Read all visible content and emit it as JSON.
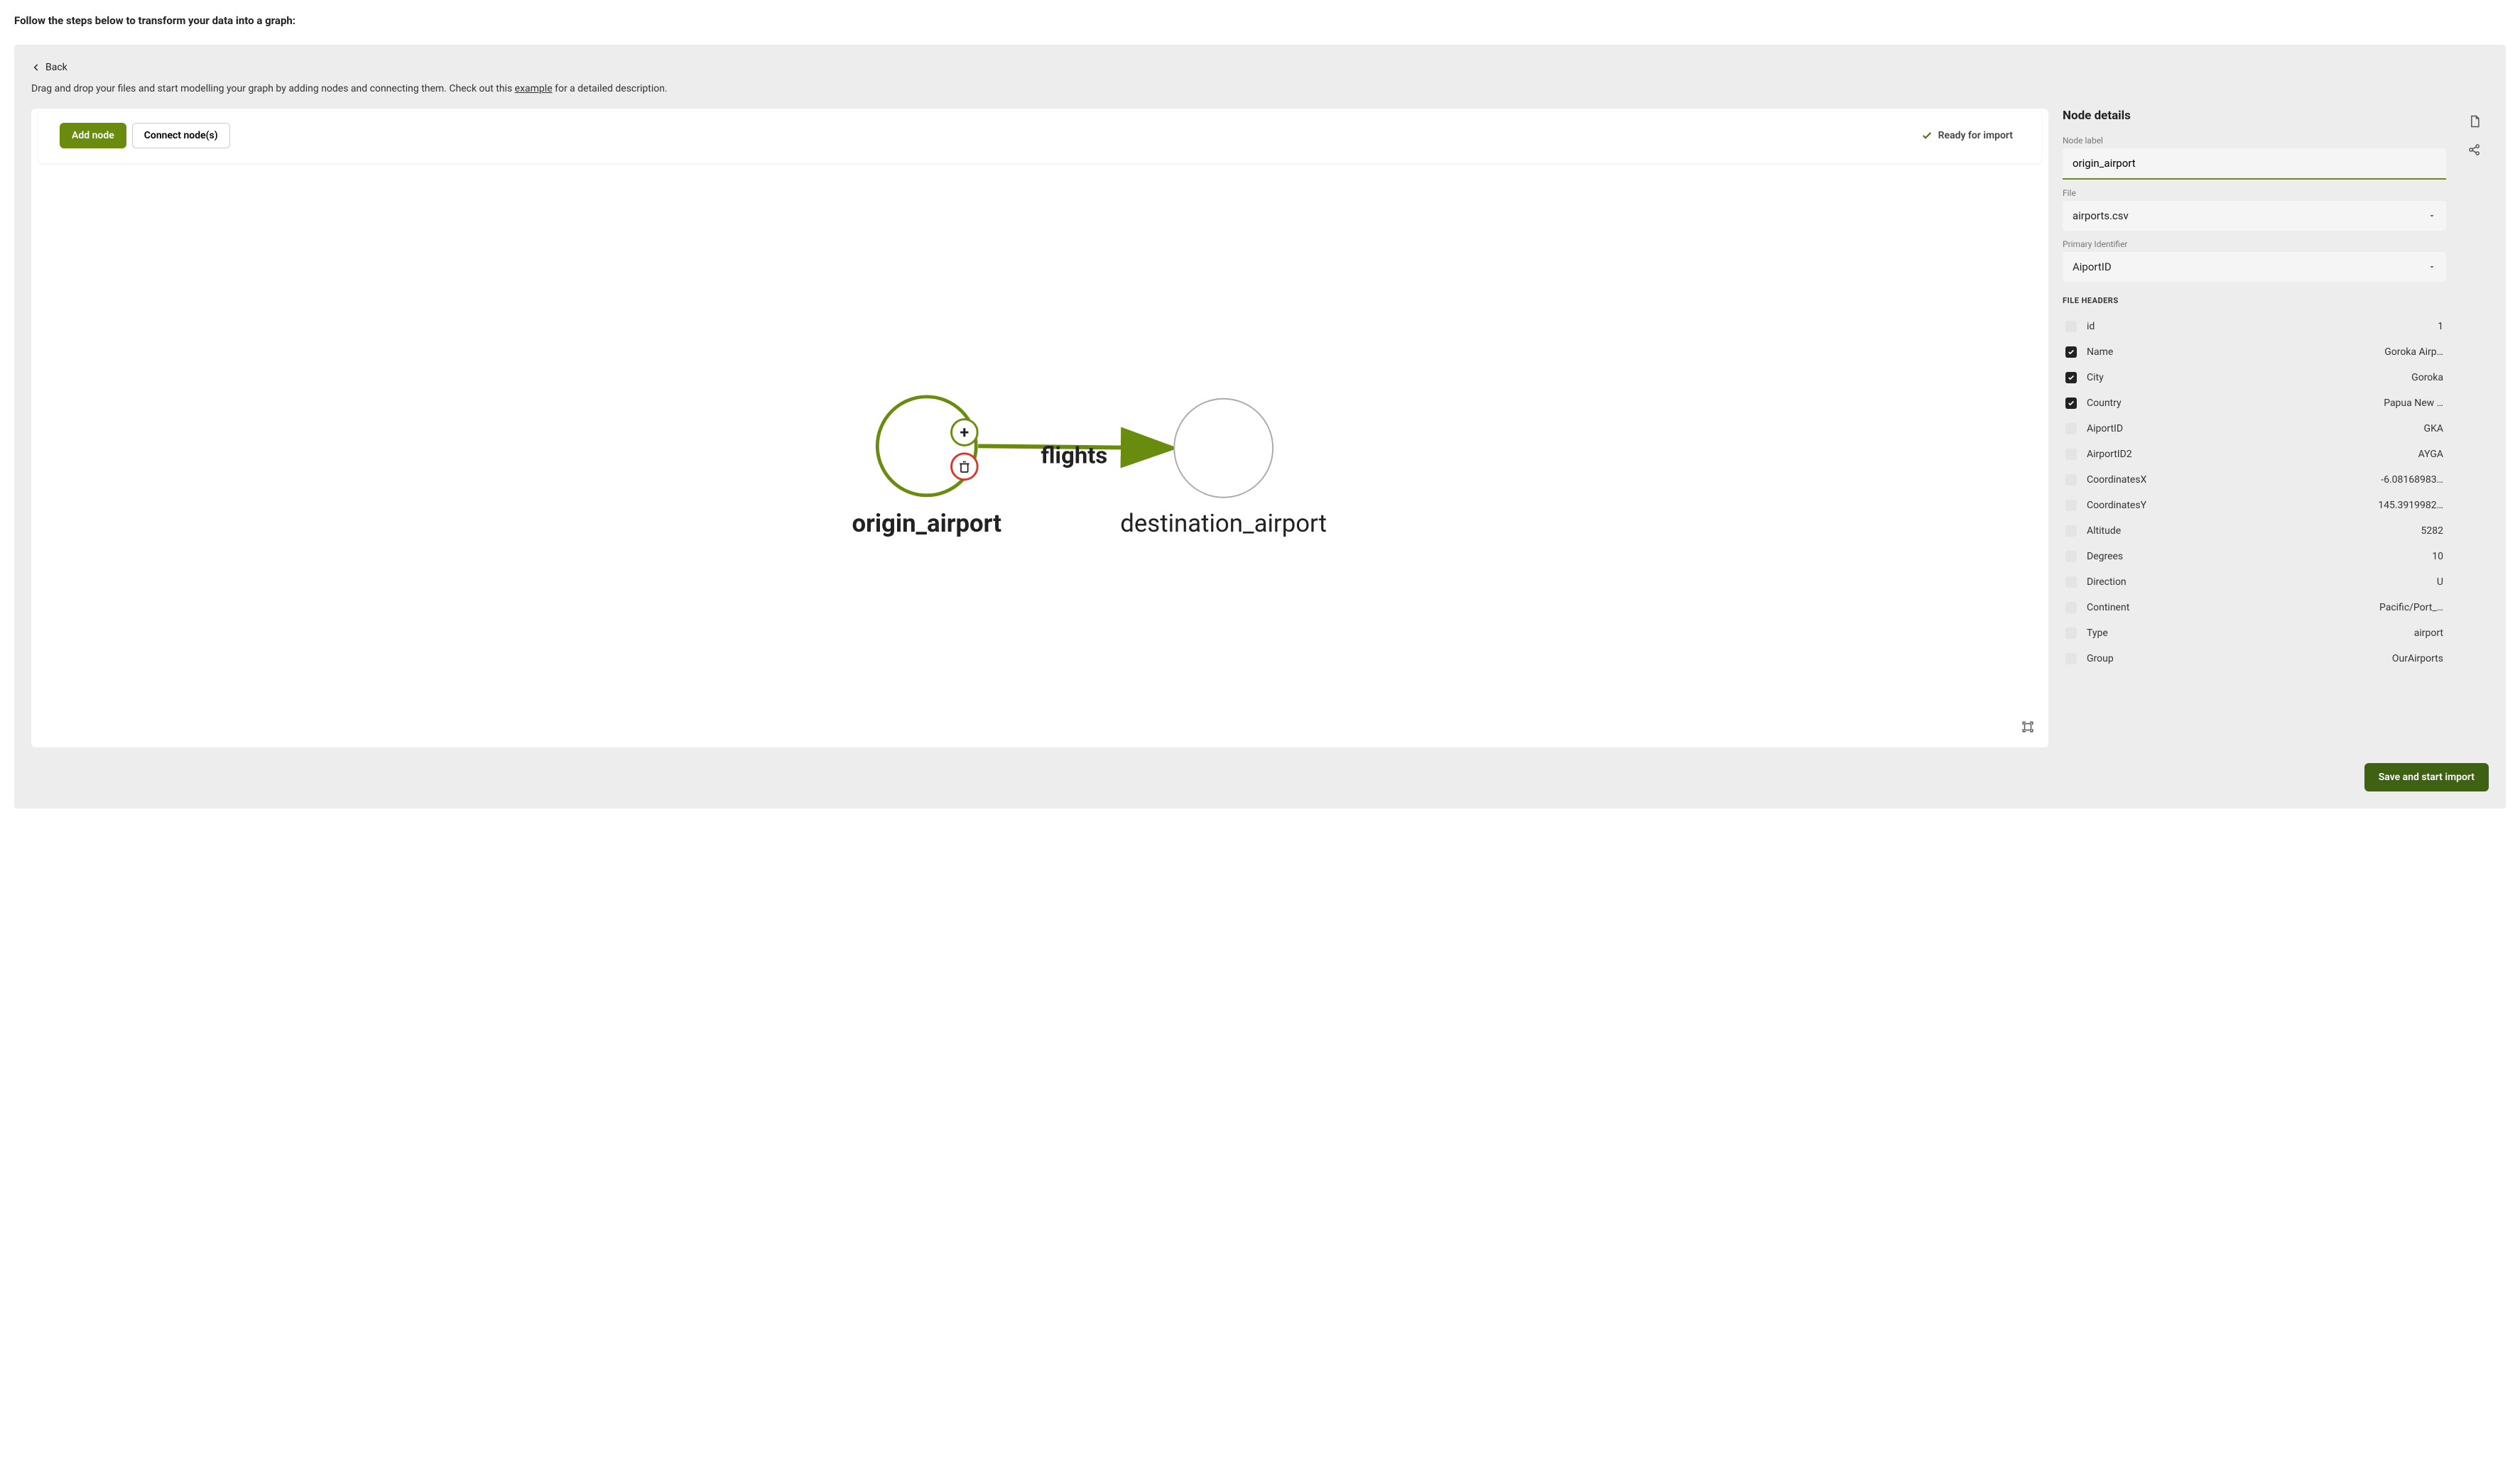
{
  "page": {
    "title": "Follow the steps below to transform your data into a graph:",
    "back_label": "Back",
    "helper_prefix": "Drag and drop your files and start modelling your graph by adding nodes and connecting them. Check out this ",
    "helper_link": "example",
    "helper_suffix": " for a detailed description."
  },
  "toolbar": {
    "add_node": "Add node",
    "connect_nodes": "Connect node(s)",
    "ready_label": "Ready for import"
  },
  "graph": {
    "edge_label": "flights",
    "nodes": {
      "origin": "origin_airport",
      "destination": "destination_airport"
    }
  },
  "details": {
    "title": "Node details",
    "labels": {
      "node_label": "Node label",
      "file": "File",
      "primary_identifier": "Primary Identifier",
      "file_headers": "FILE HEADERS"
    },
    "node_label_value": "origin_airport",
    "file_value": "airports.csv",
    "primary_identifier_value": "AiportID",
    "headers": [
      {
        "name": "id",
        "value": "1",
        "checked": false
      },
      {
        "name": "Name",
        "value": "Goroka Airp…",
        "checked": true
      },
      {
        "name": "City",
        "value": "Goroka",
        "checked": true
      },
      {
        "name": "Country",
        "value": "Papua New …",
        "checked": true
      },
      {
        "name": "AiportID",
        "value": "GKA",
        "checked": false
      },
      {
        "name": "AirportID2",
        "value": "AYGA",
        "checked": false
      },
      {
        "name": "CoordinatesX",
        "value": "-6.08168983…",
        "checked": false
      },
      {
        "name": "CoordinatesY",
        "value": "145.3919982…",
        "checked": false
      },
      {
        "name": "Altitude",
        "value": "5282",
        "checked": false
      },
      {
        "name": "Degrees",
        "value": "10",
        "checked": false
      },
      {
        "name": "Direction",
        "value": "U",
        "checked": false
      },
      {
        "name": "Continent",
        "value": "Pacific/Port_…",
        "checked": false
      },
      {
        "name": "Type",
        "value": "airport",
        "checked": false
      },
      {
        "name": "Group",
        "value": "OurAirports",
        "checked": false
      }
    ]
  },
  "footer": {
    "save_label": "Save and start import"
  }
}
